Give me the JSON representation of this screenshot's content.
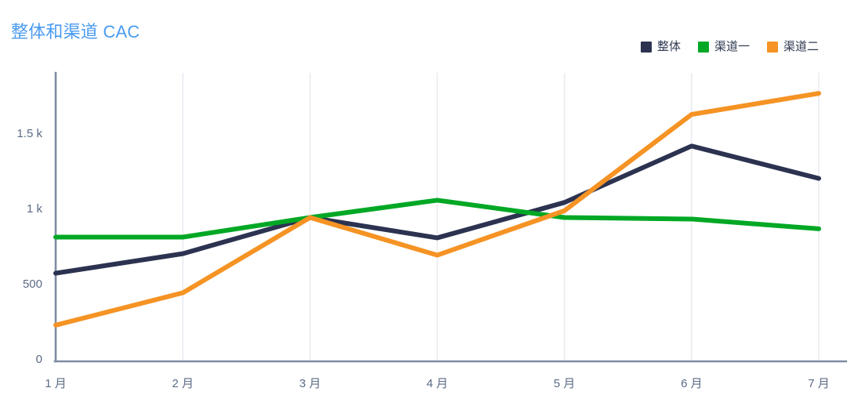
{
  "title": "整体和渠道 CAC",
  "colors": {
    "title": "#4a9bf0",
    "overall": "#2b3350",
    "channel_one": "#00a825",
    "channel_two": "#f59324",
    "axis": "#7f8da4",
    "gridline": "#e9ecf1",
    "tick_text": "#5c6b85",
    "background": "#ffffff"
  },
  "legend": {
    "position": "top-right",
    "items": [
      {
        "label": "整体",
        "color": "#2b3350",
        "icon": "square-swatch-icon"
      },
      {
        "label": "渠道一",
        "color": "#00a825",
        "icon": "square-swatch-icon"
      },
      {
        "label": "渠道二",
        "color": "#f59324",
        "icon": "square-swatch-icon"
      }
    ]
  },
  "axes": {
    "y_tick_labels": [
      "1.5 k",
      "1 k",
      "500",
      "0"
    ],
    "y_tick_values": [
      1500,
      1000,
      500,
      0
    ],
    "x_tick_labels": [
      "1 月",
      "2 月",
      "3 月",
      "4 月",
      "5 月",
      "6 月",
      "7 月"
    ]
  },
  "chart_data": {
    "type": "line",
    "title": "整体和渠道 CAC",
    "xlabel": "",
    "ylabel": "",
    "categories": [
      "1 月",
      "2 月",
      "3 月",
      "4 月",
      "5 月",
      "6 月",
      "7 月"
    ],
    "ylim": [
      0,
      1900
    ],
    "yticks": [
      0,
      500,
      1000,
      1500
    ],
    "ytick_labels": [
      "0",
      "500",
      "1 k",
      "1.5 k"
    ],
    "grid": "vertical-only",
    "legend_position": "top-right",
    "series": [
      {
        "name": "整体",
        "color": "#2b3350",
        "values": [
          570,
          700,
          940,
          805,
          1040,
          1415,
          1200
        ]
      },
      {
        "name": "渠道一",
        "color": "#00a825",
        "values": [
          810,
          810,
          940,
          1055,
          940,
          930,
          865
        ]
      },
      {
        "name": "渠道二",
        "color": "#f59324",
        "values": [
          225,
          440,
          940,
          690,
          985,
          1625,
          1765
        ]
      }
    ]
  }
}
